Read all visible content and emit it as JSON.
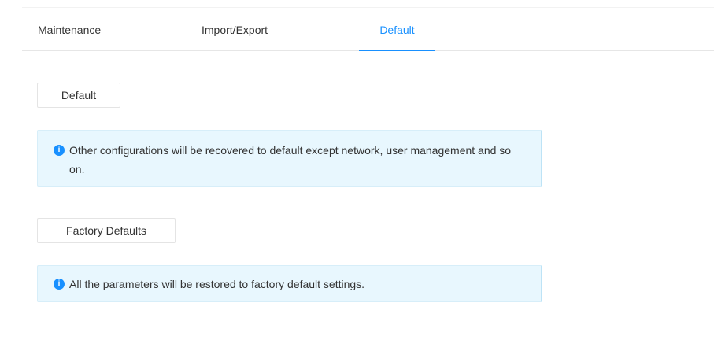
{
  "tabs": [
    {
      "label": "Maintenance",
      "active": false
    },
    {
      "label": "Import/Export",
      "active": false
    },
    {
      "label": "Default",
      "active": true
    }
  ],
  "default_section": {
    "button_label": "Default",
    "info_icon": "info-icon",
    "info_text": "Other configurations will be recovered to default except network, user management and so on."
  },
  "factory_section": {
    "button_label": "Factory Defaults",
    "info_icon": "info-icon",
    "info_text": "All the parameters will be restored to factory default settings."
  },
  "colors": {
    "accent": "#1890ff",
    "info_background": "#e8f7fe"
  }
}
